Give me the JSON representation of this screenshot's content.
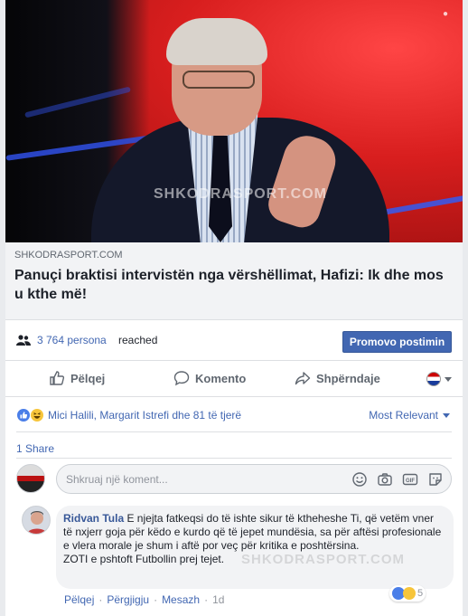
{
  "post": {
    "image_watermark": "SHKODRASPORT.COM",
    "link_domain": "SHKODRASPORT.COM",
    "headline": "Panuçi braktisi intervistën nga vërshëllimat, Hafizi: Ik dhe mos u kthe më!"
  },
  "reach": {
    "count": "3 764 persona",
    "label": "reached",
    "promote_button": "Promovo postimin",
    "people_icon": "people-icon"
  },
  "actions": {
    "like": "Pëlqej",
    "comment": "Komento",
    "share": "Shpërndaje",
    "icons": [
      "thumbs-up-icon",
      "comment-bubble-icon",
      "share-arrow-icon"
    ]
  },
  "reactions": {
    "names": "Mici Halili, Margarit Istrefi dhe 81 të tjerë",
    "sort": "Most Relevant",
    "icons": [
      "like-reaction-icon",
      "haha-reaction-icon"
    ]
  },
  "shares": "1 Share",
  "composer": {
    "placeholder": "Shkruaj një koment...",
    "icons": [
      "emoji-icon",
      "camera-icon",
      "gif-icon",
      "sticker-icon"
    ]
  },
  "comment": {
    "author": "Ridvan Tula",
    "text": "E njejta fatkeqsi do të ishte sikur të ktheheshe Ti, që vetëm vner të nxjerr goja për këdo e kurdo që të jepet mundësia, sa për aftësi profesionale e vlera morale je shum i aftë por veç për kritika e poshtërsina.\nZOTI e pshtoft Futbollin prej tejet.",
    "watermark": "SHKODRASPORT.COM",
    "like": "Pëlqej",
    "reply": "Përgjigju",
    "message": "Mesazh",
    "separator": "·",
    "time": "1d",
    "reaction_count": "5"
  },
  "colors": {
    "link_blue": "#4267b2",
    "brand_button": "#4267b2",
    "muted": "#606770"
  }
}
